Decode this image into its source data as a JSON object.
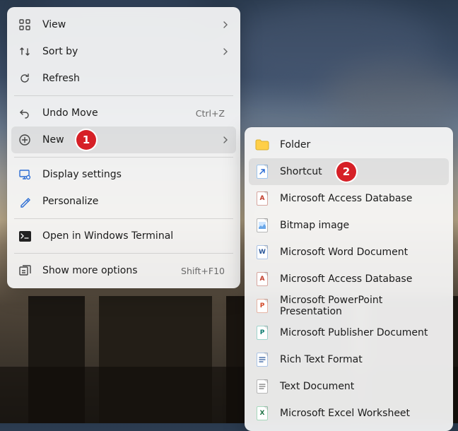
{
  "primary": {
    "view": {
      "label": "View"
    },
    "sort": {
      "label": "Sort by"
    },
    "refresh": {
      "label": "Refresh"
    },
    "undo": {
      "label": "Undo Move",
      "shortcut": "Ctrl+Z"
    },
    "new": {
      "label": "New"
    },
    "display": {
      "label": "Display settings"
    },
    "personalize": {
      "label": "Personalize"
    },
    "terminal": {
      "label": "Open in Windows Terminal"
    },
    "more": {
      "label": "Show more options",
      "shortcut": "Shift+F10"
    }
  },
  "submenu": {
    "items": [
      {
        "label": "Folder",
        "icon": "folder"
      },
      {
        "label": "Shortcut",
        "icon": "shortcut"
      },
      {
        "label": "Microsoft Access Database",
        "icon": "access"
      },
      {
        "label": "Bitmap image",
        "icon": "bitmap"
      },
      {
        "label": "Microsoft Word Document",
        "icon": "word"
      },
      {
        "label": "Microsoft Access Database",
        "icon": "access"
      },
      {
        "label": "Microsoft PowerPoint Presentation",
        "icon": "powerpoint"
      },
      {
        "label": "Microsoft Publisher Document",
        "icon": "publisher"
      },
      {
        "label": "Rich Text Format",
        "icon": "rtf"
      },
      {
        "label": "Text Document",
        "icon": "text"
      },
      {
        "label": "Microsoft Excel Worksheet",
        "icon": "excel"
      }
    ]
  },
  "callouts": {
    "one": "1",
    "two": "2"
  }
}
